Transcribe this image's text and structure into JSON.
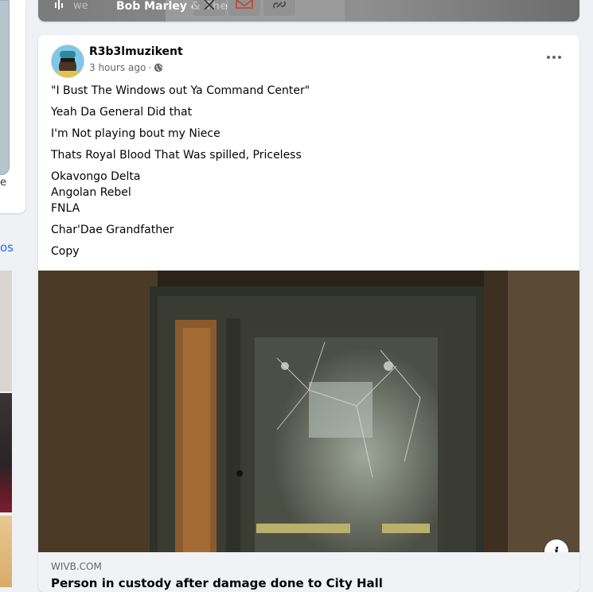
{
  "left": {
    "fragment_char": "e",
    "link_fragment": "os"
  },
  "media_bar": {
    "faded_text": "we",
    "song_text": "Bob Marley & The"
  },
  "post": {
    "author": "R3b3lmuzikent",
    "timestamp": "3 hours ago",
    "separator": "·",
    "privacy_icon": "globe-icon",
    "more_icon": "more-icon",
    "paragraphs": [
      "\"I Bust The Windows out Ya Command Center\"",
      "Yeah Da General Did that",
      "I'm Not playing bout my Niece",
      "Thats Royal Blood That Was spilled, Priceless"
    ],
    "lines": [
      "Okavongo Delta",
      "Angolan Rebel",
      "FNLA"
    ],
    "tail": [
      "Char'Dae Grandfather",
      "Copy"
    ],
    "link": {
      "domain": "WIVB.COM",
      "headline": "Person in custody after damage done to City Hall"
    }
  },
  "colors": {
    "link_blue": "#1877f2",
    "card_bg": "#ffffff",
    "page_bg": "#eff1f4",
    "secondary_text": "#65676b"
  }
}
